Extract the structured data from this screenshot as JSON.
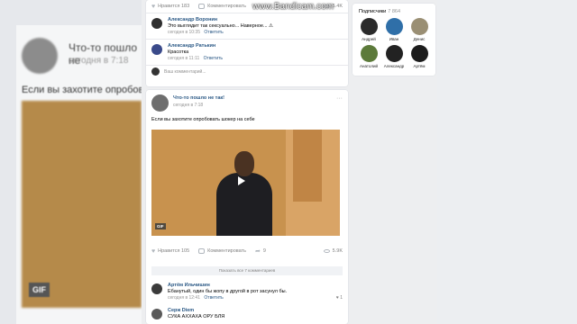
{
  "watermark": "www.Bandicam.com",
  "background": {
    "post_title": "Что-то пошло не",
    "post_date": "сегодня в 7:18",
    "post_text": "Если вы захотите опробова",
    "gif_badge": "GIF"
  },
  "post1": {
    "likes_label": "Нравится",
    "likes_count": "183",
    "comment_label": "Комментировать",
    "views": "6.4K",
    "comments": [
      {
        "author": "Александр Воронин",
        "text": "Это выглядит так сексуально... Наверное... ⚠",
        "date": "сегодня в 10:35",
        "reply": "Ответить",
        "likes": "",
        "avatar_color": "#2f2f2f"
      },
      {
        "author": "Александр Ратькин",
        "text": "Красотка",
        "date": "сегодня в 11:11",
        "reply": "Ответить",
        "likes": "",
        "avatar_color": "#3a4a8a"
      }
    ],
    "add_comment": "Ваш комментарий..."
  },
  "post2": {
    "title": "Что-то пошло не так!",
    "date": "сегодня в 7:18",
    "menu": "···",
    "text": "Если вы захотите опробовать шокер на себе",
    "gif_badge": "GIF",
    "likes_label": "Нравится",
    "likes_count": "105",
    "comment_label": "Комментировать",
    "share_count": "9",
    "views": "5.9K",
    "show_all": "Показать все 7 комментариев",
    "comments": [
      {
        "author": "Артём Ильчишин",
        "text": "Ебанутый, один бы жопу в другой в рот засунул бы.",
        "date": "сегодня в 12:41",
        "reply": "Ответить",
        "likes": "1",
        "avatar_color": "#3b3b3b"
      },
      {
        "author": "Серж Diem",
        "text": "СУКА АХХАХА ОРУ БЛЯ",
        "date": "",
        "reply": "",
        "likes": "",
        "avatar_color": "#5a5a5a"
      }
    ]
  },
  "subscribers": {
    "title": "Подписчики",
    "count": "7 864",
    "items": [
      {
        "name": "Андрей",
        "color": "#2b2b2b"
      },
      {
        "name": "Иван",
        "color": "#2f6fa8"
      },
      {
        "name": "Денис",
        "color": "#9a8f74"
      },
      {
        "name": "Анатолий",
        "color": "#5c7a3a"
      },
      {
        "name": "Александр",
        "color": "#222222"
      },
      {
        "name": "Артём",
        "color": "#1c1c1c"
      }
    ]
  }
}
